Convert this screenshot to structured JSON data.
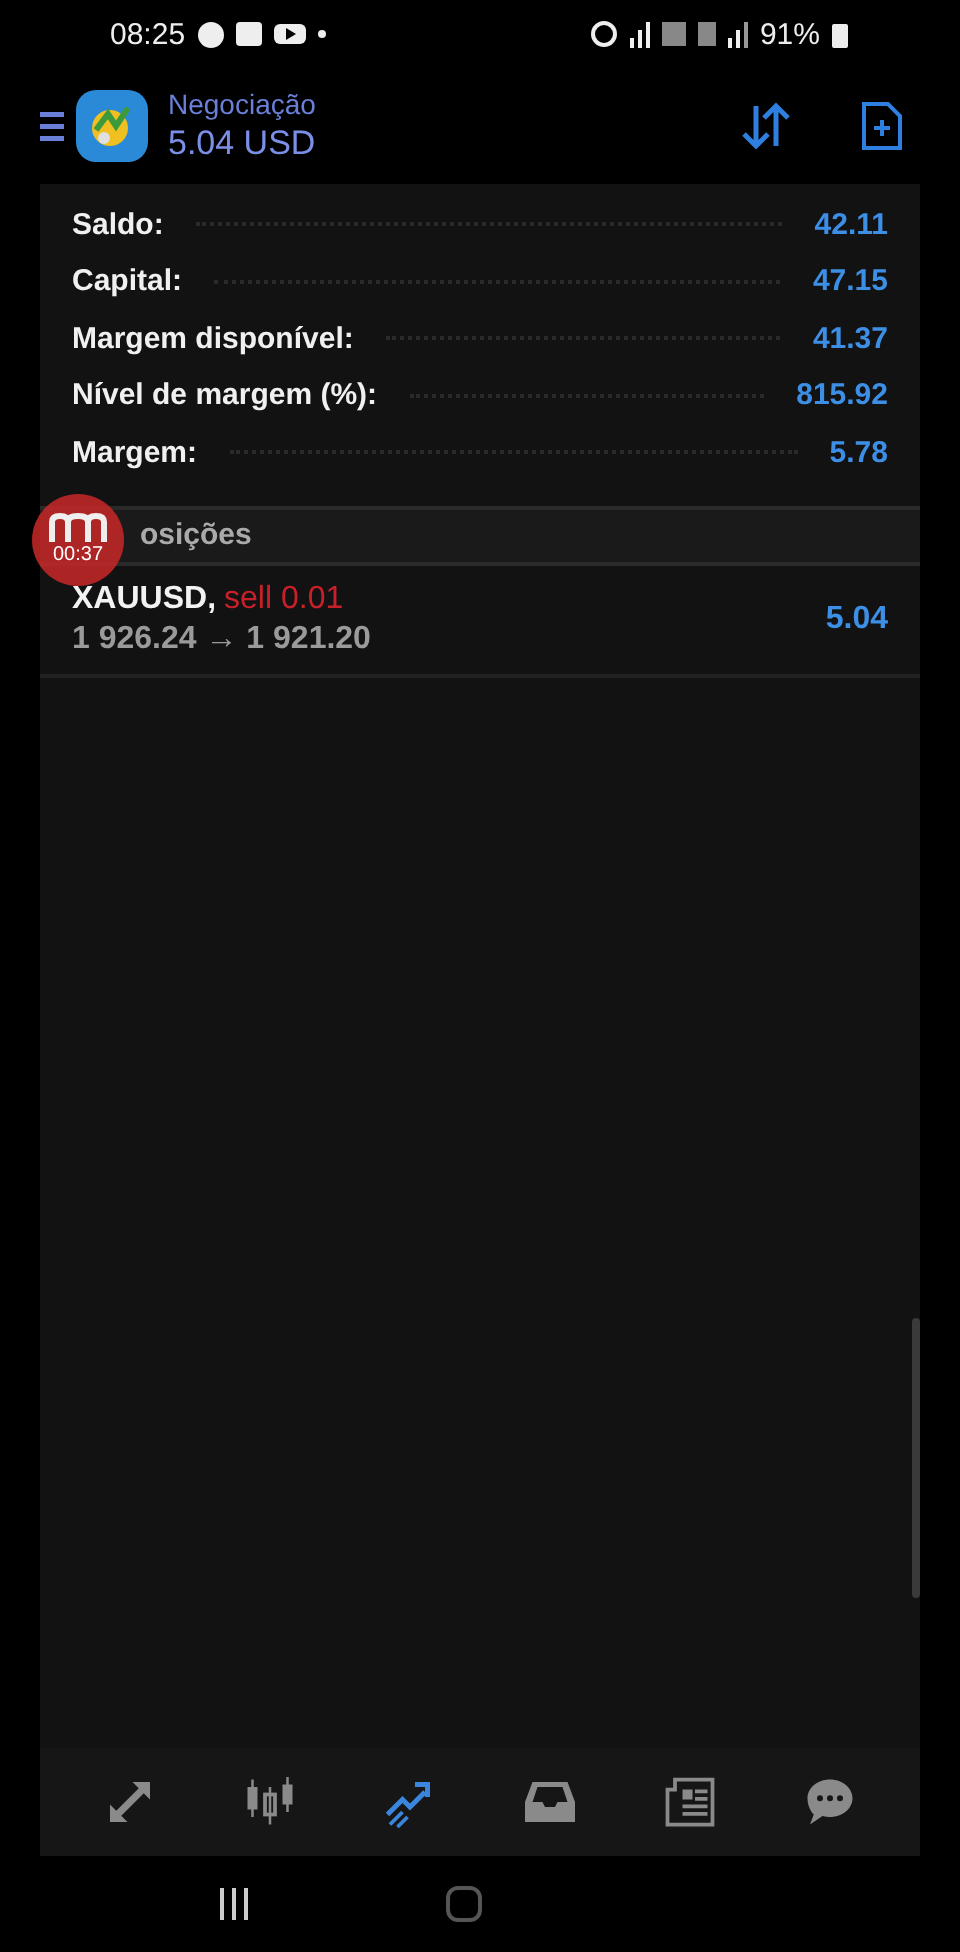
{
  "status_bar": {
    "time": "08:25",
    "battery": "91%"
  },
  "header": {
    "title": "Negociação",
    "balance": "5.04 USD"
  },
  "summary": [
    {
      "label": "Saldo:",
      "value": "42.11"
    },
    {
      "label": "Capital:",
      "value": "47.15"
    },
    {
      "label": "Margem disponível:",
      "value": "41.37"
    },
    {
      "label": "Nível de margem (%):",
      "value": "815.92"
    },
    {
      "label": "Margem:",
      "value": "5.78"
    }
  ],
  "recorder_bubble": {
    "time": "00:37"
  },
  "positions": {
    "title": "osições",
    "items": [
      {
        "symbol": "XAUUSD,",
        "side": "sell 0.01",
        "prices": "1 926.24 → 1 921.20",
        "profit": "5.04"
      }
    ]
  },
  "nav": [
    {
      "kind": "quotes",
      "selected": false
    },
    {
      "kind": "chart",
      "selected": false
    },
    {
      "kind": "trade",
      "selected": true
    },
    {
      "kind": "history",
      "selected": false
    },
    {
      "kind": "news",
      "selected": false
    },
    {
      "kind": "messages",
      "selected": false
    }
  ]
}
